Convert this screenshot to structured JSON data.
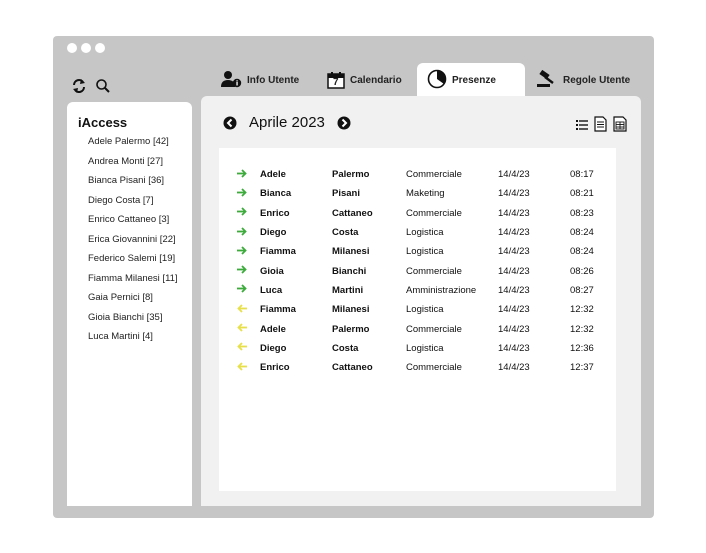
{
  "app": {
    "brand": "iAccess"
  },
  "colors": {
    "window_bg": "#c6c6c6",
    "panel_bg": "#f1f1f1",
    "entry": "#3cab3c",
    "exit": "#e8e04a"
  },
  "toolbar": {
    "refresh_icon": "refresh-icon",
    "search_icon": "search-icon"
  },
  "tabs": [
    {
      "label": "Info Utente",
      "icon": "user-info-icon"
    },
    {
      "label": "Calendario",
      "icon": "calendar-icon",
      "icon_text": "7"
    },
    {
      "label": "Presenze",
      "icon": "clock-icon",
      "active": true
    },
    {
      "label": "Regole Utente",
      "icon": "gavel-icon"
    }
  ],
  "sidebar": {
    "users": [
      "Adele Palermo [42]",
      "Andrea Monti [27]",
      "Bianca Pisani [36]",
      "Diego Costa [7]",
      "Enrico Cattaneo [3]",
      "Erica Giovannini [22]",
      "Federico Salemi [19]",
      "Fiamma Milanesi [11]",
      "Gaia Pernici [8]",
      "Gioia Bianchi [35]",
      "Luca Martini [4]"
    ]
  },
  "main": {
    "month_label": "Aprile 2023",
    "prev_icon": "arrow-left-circle-icon",
    "next_icon": "arrow-right-circle-icon",
    "view_icons": [
      "list-icon",
      "document-icon",
      "table-icon"
    ],
    "rows": [
      {
        "dir": "in",
        "first": "Adele",
        "last": "Palermo",
        "dept": "Commerciale",
        "date": "14/4/23",
        "time": "08:17"
      },
      {
        "dir": "in",
        "first": "Bianca",
        "last": "Pisani",
        "dept": "Maketing",
        "date": "14/4/23",
        "time": "08:21"
      },
      {
        "dir": "in",
        "first": "Enrico",
        "last": "Cattaneo",
        "dept": "Commerciale",
        "date": "14/4/23",
        "time": "08:23"
      },
      {
        "dir": "in",
        "first": "Diego",
        "last": "Costa",
        "dept": "Logistica",
        "date": "14/4/23",
        "time": "08:24"
      },
      {
        "dir": "in",
        "first": "Fiamma",
        "last": "Milanesi",
        "dept": "Logistica",
        "date": "14/4/23",
        "time": "08:24"
      },
      {
        "dir": "in",
        "first": "Gioia",
        "last": "Bianchi",
        "dept": "Commerciale",
        "date": "14/4/23",
        "time": "08:26"
      },
      {
        "dir": "in",
        "first": "Luca",
        "last": "Martini",
        "dept": "Amministrazione",
        "date": "14/4/23",
        "time": "08:27"
      },
      {
        "dir": "out",
        "first": "Fiamma",
        "last": "Milanesi",
        "dept": "Logistica",
        "date": "14/4/23",
        "time": "12:32"
      },
      {
        "dir": "out",
        "first": "Adele",
        "last": "Palermo",
        "dept": "Commerciale",
        "date": "14/4/23",
        "time": "12:32"
      },
      {
        "dir": "out",
        "first": "Diego",
        "last": "Costa",
        "dept": "Logistica",
        "date": "14/4/23",
        "time": "12:36"
      },
      {
        "dir": "out",
        "first": "Enrico",
        "last": "Cattaneo",
        "dept": "Commerciale",
        "date": "14/4/23",
        "time": "12:37"
      }
    ]
  }
}
